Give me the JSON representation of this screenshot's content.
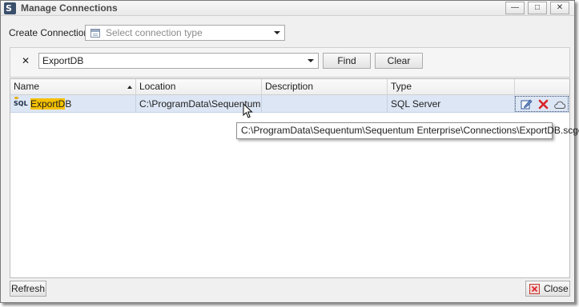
{
  "window": {
    "title": "Manage Connections",
    "app_icon_glyph": "S",
    "controls": {
      "minimize": "—",
      "maximize": "□",
      "close": "✕"
    }
  },
  "create_connection": {
    "label": "Create Connection",
    "placeholder": "Select connection type"
  },
  "search": {
    "clear_glyph": "✕",
    "value": "ExportDB",
    "find_label": "Find",
    "clear_label": "Clear"
  },
  "grid": {
    "columns": [
      "Name",
      "Location",
      "Description",
      "Type"
    ],
    "rows": [
      {
        "icon": "SQL",
        "name_highlight": "ExportD",
        "name_rest": "B",
        "location": "C:\\ProgramData\\Sequentum...",
        "description": "",
        "type": "SQL Server"
      }
    ]
  },
  "tooltip": {
    "text": "C:\\ProgramData\\Sequentum\\Sequentum Enterprise\\Connections\\ExportDB.scgc"
  },
  "footer": {
    "refresh_label": "Refresh",
    "close_label": "Close"
  },
  "colors": {
    "selected_row": "#dde6f4",
    "highlight": "#f5c000",
    "delete_red": "#d9242a",
    "edit_blue": "#2f5597"
  }
}
